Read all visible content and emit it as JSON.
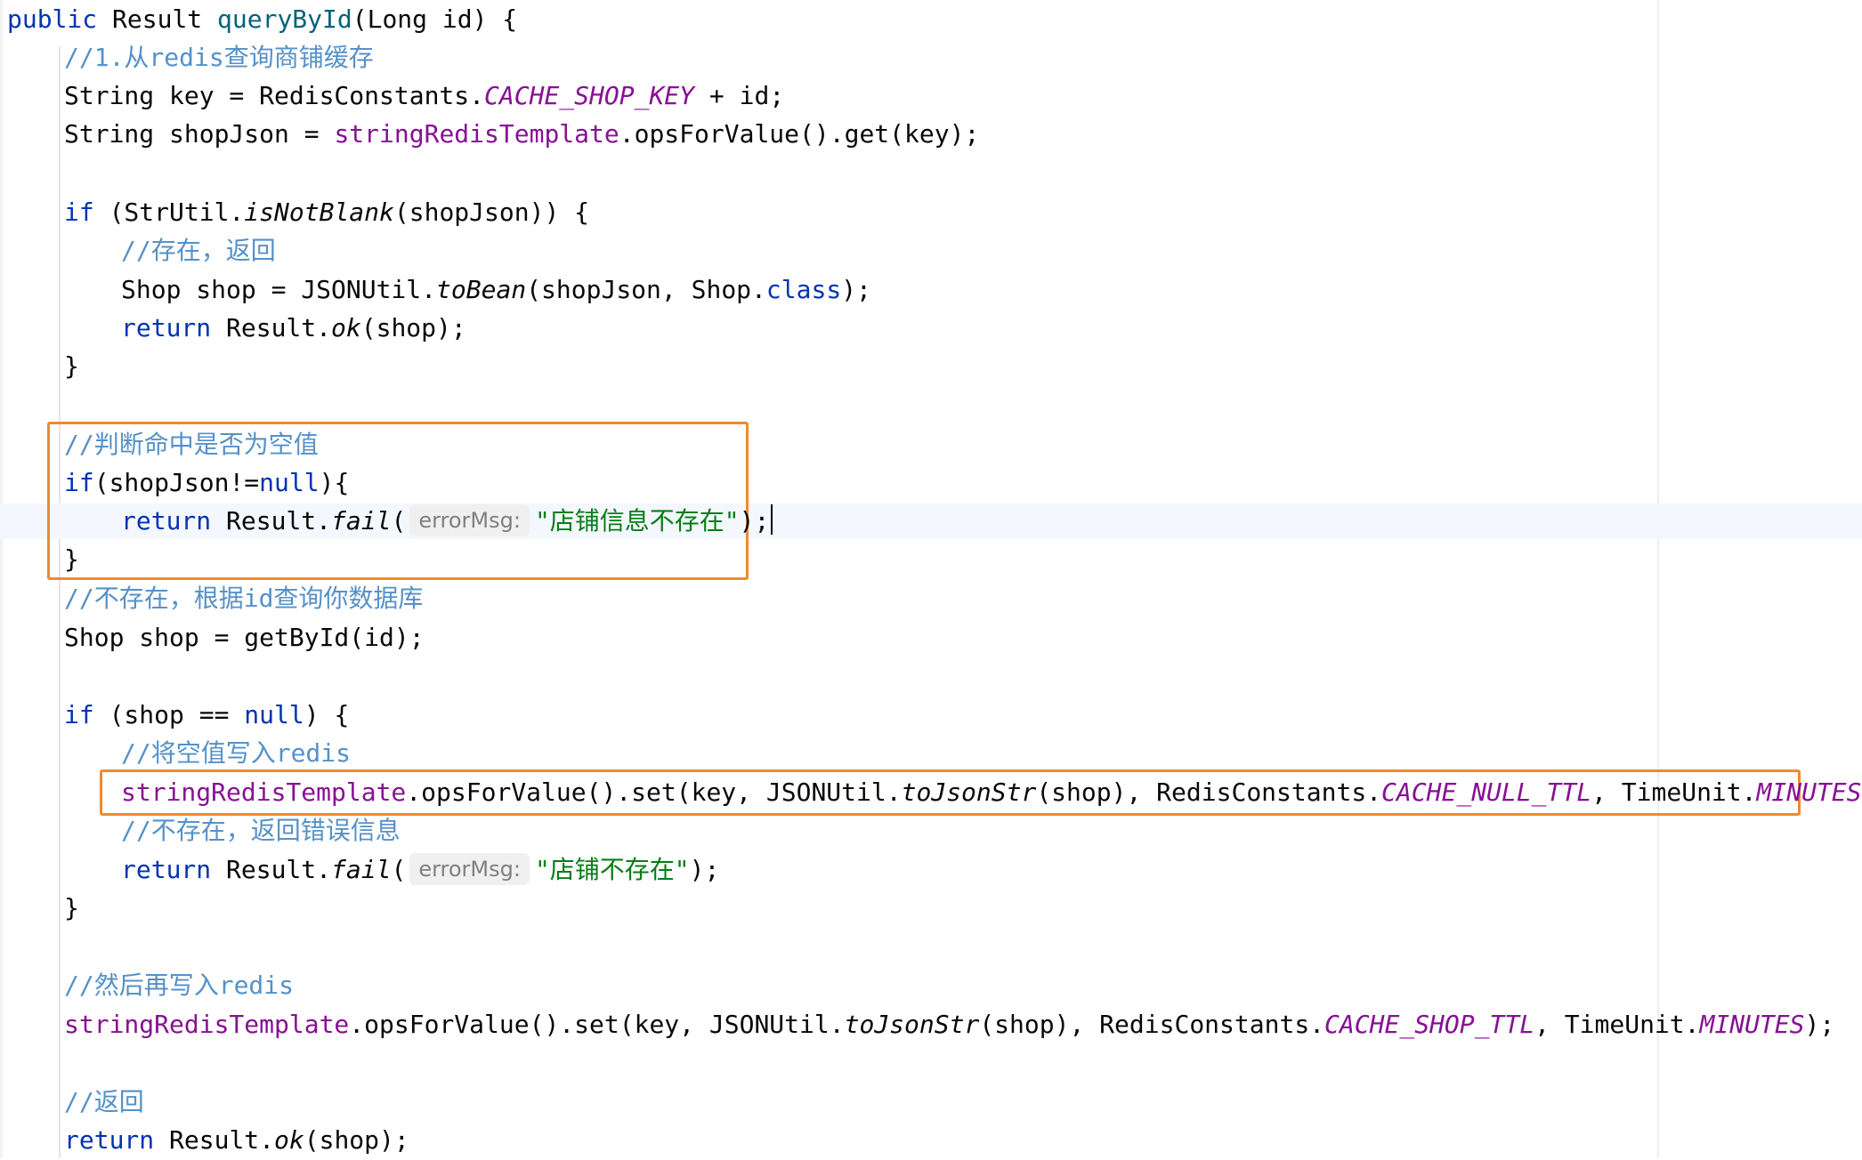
{
  "code": {
    "l1": {
      "kw": "public",
      "t1": " Result ",
      "m": "queryById",
      "t2": "(Long id) {"
    },
    "l2": {
      "c": "//1.从redis查询商铺缓存"
    },
    "l3": {
      "t1": "String key = RedisConstants.",
      "f": "CACHE_SHOP_KEY",
      "t2": " + id;"
    },
    "l4": {
      "t1": "String shopJson = ",
      "f": "stringRedisTemplate",
      "t2": ".opsForValue().get(key);"
    },
    "l5": {
      "kw": "if",
      "t1": " (StrUtil.",
      "i": "isNotBlank",
      "t2": "(shopJson)) {"
    },
    "l6": {
      "c": "//存在，返回"
    },
    "l7": {
      "t1": "Shop shop = JSONUtil.",
      "i": "toBean",
      "t2": "(shopJson, Shop.",
      "kw": "class",
      "t3": ");"
    },
    "l8": {
      "kw": "return",
      "t1": " Result.",
      "i": "ok",
      "t2": "(shop);"
    },
    "l9": {
      "t": "}"
    },
    "l10": {
      "c": "//判断命中是否为空值"
    },
    "l11": {
      "kw": "if",
      "t1": "(shopJson!=",
      "kw2": "null",
      "t2": "){"
    },
    "l12": {
      "kw": "return",
      "t1": " Result.",
      "i": "fail",
      "t2": "(",
      "hint": "errorMsg:",
      "s": "\"店铺信息不存在\"",
      "t3": ");"
    },
    "l13": {
      "t": "}"
    },
    "l14": {
      "c": "//不存在，根据id查询你数据库"
    },
    "l15": {
      "t": "Shop shop = getById(id);"
    },
    "l16": {
      "kw": "if",
      "t1": " (shop == ",
      "kw2": "null",
      "t2": ") {"
    },
    "l17": {
      "c": "//将空值写入redis"
    },
    "l18": {
      "f": "stringRedisTemplate",
      "t1": ".opsForValue().set(key, JSONUtil.",
      "i": "toJsonStr",
      "t2": "(shop), RedisConstants.",
      "f2": "CACHE_NULL_TTL",
      "t3": ", TimeUnit.",
      "f3": "MINUTES",
      "t4": ");"
    },
    "l19": {
      "c": "//不存在，返回错误信息"
    },
    "l20": {
      "kw": "return",
      "t1": " Result.",
      "i": "fail",
      "t2": "(",
      "hint": "errorMsg:",
      "s": "\"店铺不存在\"",
      "t3": ");"
    },
    "l21": {
      "t": "}"
    },
    "l22": {
      "c": "//然后再写入redis"
    },
    "l23": {
      "f": "stringRedisTemplate",
      "t1": ".opsForValue().set(key, JSONUtil.",
      "i": "toJsonStr",
      "t2": "(shop), RedisConstants.",
      "f2": "CACHE_SHOP_TTL",
      "t3": ", TimeUnit.",
      "f3": "MINUTES",
      "t4": ");"
    },
    "l24": {
      "c": "//返回"
    },
    "l25": {
      "kw": "return",
      "t1": " Result.",
      "i": "ok",
      "t2": "(shop);"
    }
  },
  "colors": {
    "keyword": "#0033b3",
    "method": "#00627a",
    "field": "#871094",
    "string": "#067d17",
    "comment": "#5591c8",
    "highlight_box": "#f08a2c"
  }
}
